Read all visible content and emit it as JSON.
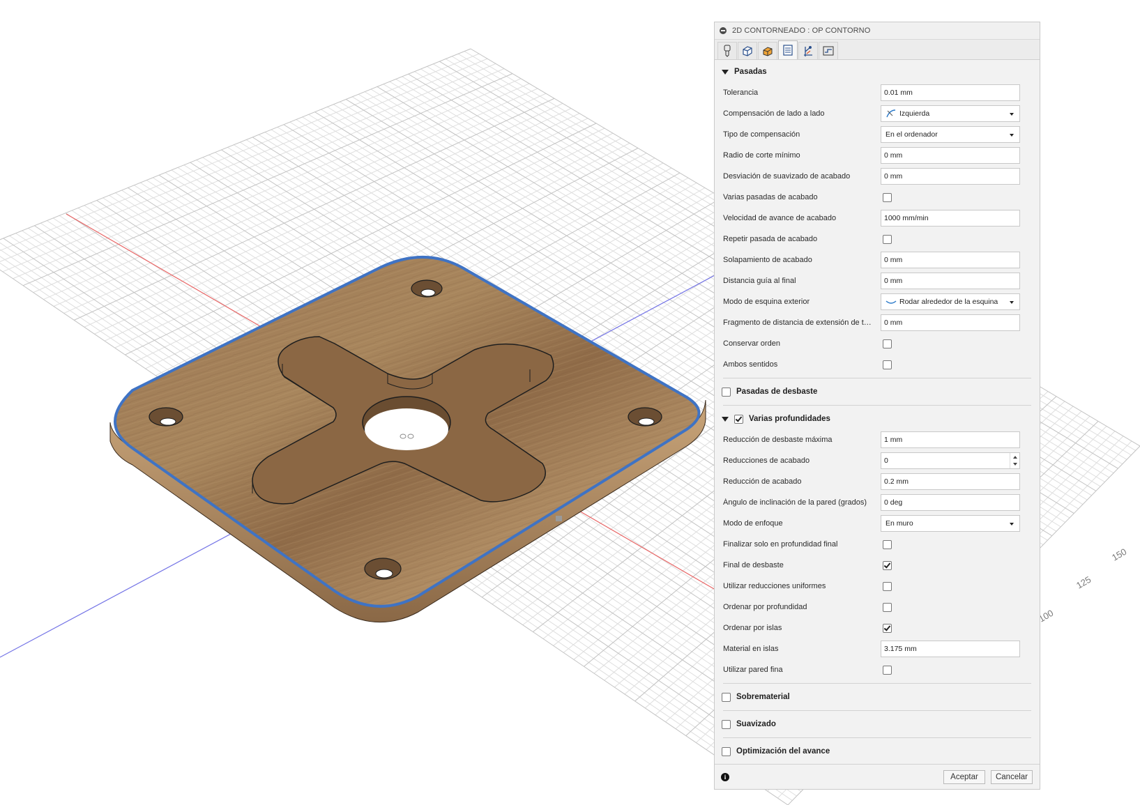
{
  "viewport": {
    "axis_labels": [
      "150",
      "125",
      "100"
    ]
  },
  "panel": {
    "title": "2D CONTORNEADO : OP CONTORNO",
    "tabs": [
      {
        "icon": "tool-icon"
      },
      {
        "icon": "geometry-icon"
      },
      {
        "icon": "heights-icon"
      },
      {
        "icon": "passes-icon"
      },
      {
        "icon": "linking-icon"
      },
      {
        "icon": "simulation-icon"
      }
    ],
    "active_tab": 3,
    "sections": {
      "pasadas": {
        "label": "Pasadas",
        "rows": [
          {
            "label": "Tolerancia",
            "value": "0.01 mm"
          },
          {
            "label": "Compensación de lado a lado",
            "value": "Izquierda"
          },
          {
            "label": "Tipo de compensación",
            "value": "En el ordenador"
          },
          {
            "label": "Radio de corte mínimo",
            "value": "0 mm"
          },
          {
            "label": "Desviación de suavizado de acabado",
            "value": "0 mm"
          },
          {
            "label": "Varias pasadas de acabado",
            "checked": false
          },
          {
            "label": "Velocidad de avance de acabado",
            "value": "1000 mm/min"
          },
          {
            "label": "Repetir pasada de acabado",
            "checked": false
          },
          {
            "label": "Solapamiento de acabado",
            "value": "0 mm"
          },
          {
            "label": "Distancia guía al final",
            "value": "0 mm"
          },
          {
            "label": "Modo de esquina exterior",
            "value": "Rodar alrededor de la esquina"
          },
          {
            "label": "Fragmento de distancia de extensión de tan...",
            "value": "0 mm"
          },
          {
            "label": "Conservar orden",
            "checked": false
          },
          {
            "label": "Ambos sentidos",
            "checked": false
          }
        ]
      },
      "desbaste": {
        "label": "Pasadas de desbaste",
        "checked": false
      },
      "profundidades": {
        "label": "Varias profundidades",
        "checked": true,
        "rows": [
          {
            "label": "Reducción de desbaste máxima",
            "value": "1 mm"
          },
          {
            "label": "Reducciones de acabado",
            "value": "0"
          },
          {
            "label": "Reducción de acabado",
            "value": "0.2 mm"
          },
          {
            "label": "Ángulo de inclinación de la pared (grados)",
            "value": "0 deg"
          },
          {
            "label": "Modo de enfoque",
            "value": "En muro"
          },
          {
            "label": "Finalizar solo en profundidad final",
            "checked": false
          },
          {
            "label": "Final de desbaste",
            "checked": true
          },
          {
            "label": "Utilizar reducciones uniformes",
            "checked": false
          },
          {
            "label": "Ordenar por profundidad",
            "checked": false
          },
          {
            "label": "Ordenar por islas",
            "checked": true
          },
          {
            "label": "Material en islas",
            "value": "3.175 mm"
          },
          {
            "label": "Utilizar pared fina",
            "checked": false
          }
        ]
      },
      "sobrematerial": {
        "label": "Sobrematerial",
        "checked": false
      },
      "suavizado": {
        "label": "Suavizado",
        "checked": false
      },
      "optimizacion": {
        "label": "Optimización del avance",
        "checked": false
      }
    },
    "footer": {
      "ok_label": "Aceptar",
      "cancel_label": "Cancelar"
    }
  },
  "colors": {
    "panel_bg": "#f2f2f2",
    "wood": "#a98459",
    "contour_selection": "#3f73c4",
    "x_axis": "#e86565",
    "y_axis": "#7373e6"
  }
}
